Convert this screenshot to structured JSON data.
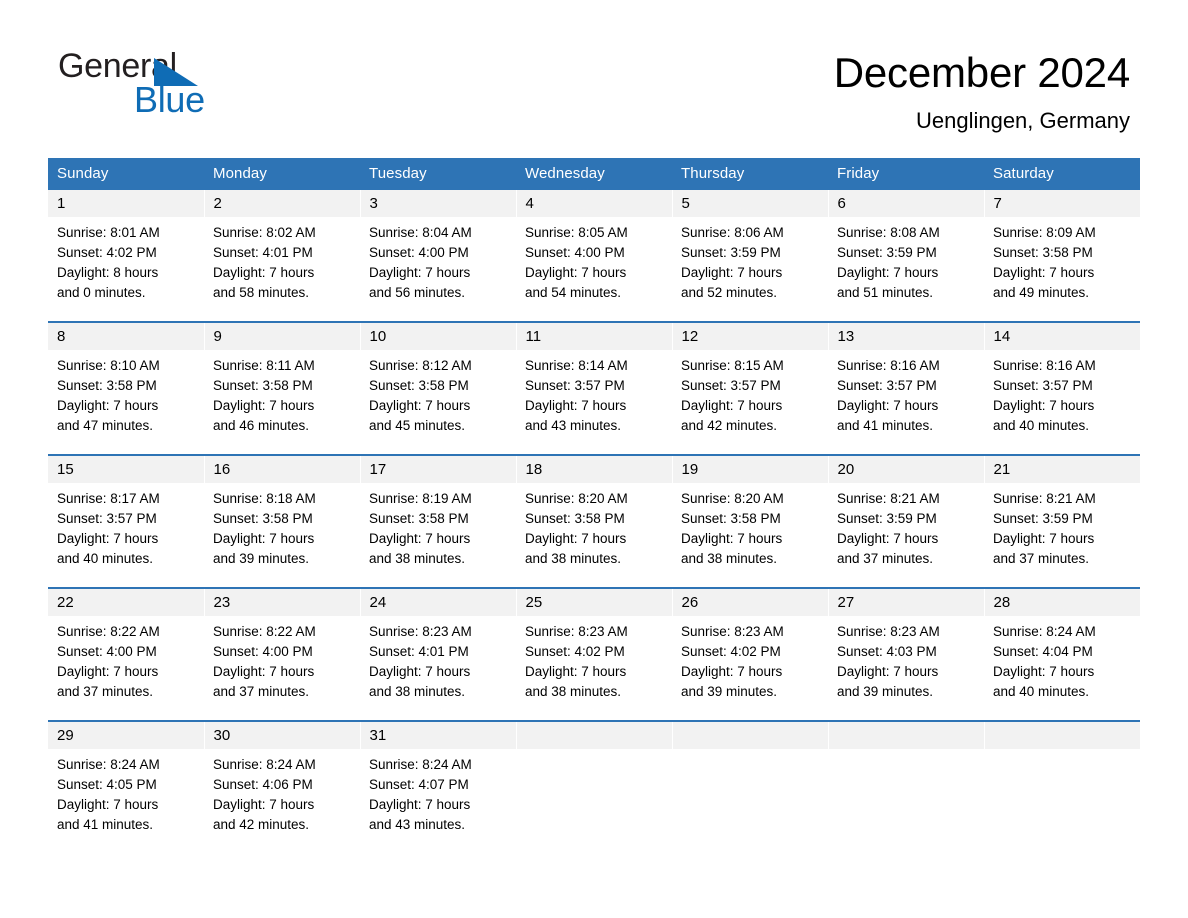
{
  "brand": {
    "name_part1": "General",
    "name_part2": "Blue",
    "triangle_color": "#0f6cb5"
  },
  "header": {
    "title": "December 2024",
    "location": "Uenglingen, Germany"
  },
  "theme": {
    "header_blue": "#2e74b5",
    "daynum_background": "#f2f2f2",
    "page_background": "#ffffff",
    "text_color": "#000000"
  },
  "calendar": {
    "weekday_headers": [
      "Sunday",
      "Monday",
      "Tuesday",
      "Wednesday",
      "Thursday",
      "Friday",
      "Saturday"
    ],
    "weeks": [
      {
        "days": [
          {
            "num": "1",
            "sunrise": "Sunrise: 8:01 AM",
            "sunset": "Sunset: 4:02 PM",
            "daylight_1": "Daylight: 8 hours",
            "daylight_2": "and 0 minutes."
          },
          {
            "num": "2",
            "sunrise": "Sunrise: 8:02 AM",
            "sunset": "Sunset: 4:01 PM",
            "daylight_1": "Daylight: 7 hours",
            "daylight_2": "and 58 minutes."
          },
          {
            "num": "3",
            "sunrise": "Sunrise: 8:04 AM",
            "sunset": "Sunset: 4:00 PM",
            "daylight_1": "Daylight: 7 hours",
            "daylight_2": "and 56 minutes."
          },
          {
            "num": "4",
            "sunrise": "Sunrise: 8:05 AM",
            "sunset": "Sunset: 4:00 PM",
            "daylight_1": "Daylight: 7 hours",
            "daylight_2": "and 54 minutes."
          },
          {
            "num": "5",
            "sunrise": "Sunrise: 8:06 AM",
            "sunset": "Sunset: 3:59 PM",
            "daylight_1": "Daylight: 7 hours",
            "daylight_2": "and 52 minutes."
          },
          {
            "num": "6",
            "sunrise": "Sunrise: 8:08 AM",
            "sunset": "Sunset: 3:59 PM",
            "daylight_1": "Daylight: 7 hours",
            "daylight_2": "and 51 minutes."
          },
          {
            "num": "7",
            "sunrise": "Sunrise: 8:09 AM",
            "sunset": "Sunset: 3:58 PM",
            "daylight_1": "Daylight: 7 hours",
            "daylight_2": "and 49 minutes."
          }
        ]
      },
      {
        "days": [
          {
            "num": "8",
            "sunrise": "Sunrise: 8:10 AM",
            "sunset": "Sunset: 3:58 PM",
            "daylight_1": "Daylight: 7 hours",
            "daylight_2": "and 47 minutes."
          },
          {
            "num": "9",
            "sunrise": "Sunrise: 8:11 AM",
            "sunset": "Sunset: 3:58 PM",
            "daylight_1": "Daylight: 7 hours",
            "daylight_2": "and 46 minutes."
          },
          {
            "num": "10",
            "sunrise": "Sunrise: 8:12 AM",
            "sunset": "Sunset: 3:58 PM",
            "daylight_1": "Daylight: 7 hours",
            "daylight_2": "and 45 minutes."
          },
          {
            "num": "11",
            "sunrise": "Sunrise: 8:14 AM",
            "sunset": "Sunset: 3:57 PM",
            "daylight_1": "Daylight: 7 hours",
            "daylight_2": "and 43 minutes."
          },
          {
            "num": "12",
            "sunrise": "Sunrise: 8:15 AM",
            "sunset": "Sunset: 3:57 PM",
            "daylight_1": "Daylight: 7 hours",
            "daylight_2": "and 42 minutes."
          },
          {
            "num": "13",
            "sunrise": "Sunrise: 8:16 AM",
            "sunset": "Sunset: 3:57 PM",
            "daylight_1": "Daylight: 7 hours",
            "daylight_2": "and 41 minutes."
          },
          {
            "num": "14",
            "sunrise": "Sunrise: 8:16 AM",
            "sunset": "Sunset: 3:57 PM",
            "daylight_1": "Daylight: 7 hours",
            "daylight_2": "and 40 minutes."
          }
        ]
      },
      {
        "days": [
          {
            "num": "15",
            "sunrise": "Sunrise: 8:17 AM",
            "sunset": "Sunset: 3:57 PM",
            "daylight_1": "Daylight: 7 hours",
            "daylight_2": "and 40 minutes."
          },
          {
            "num": "16",
            "sunrise": "Sunrise: 8:18 AM",
            "sunset": "Sunset: 3:58 PM",
            "daylight_1": "Daylight: 7 hours",
            "daylight_2": "and 39 minutes."
          },
          {
            "num": "17",
            "sunrise": "Sunrise: 8:19 AM",
            "sunset": "Sunset: 3:58 PM",
            "daylight_1": "Daylight: 7 hours",
            "daylight_2": "and 38 minutes."
          },
          {
            "num": "18",
            "sunrise": "Sunrise: 8:20 AM",
            "sunset": "Sunset: 3:58 PM",
            "daylight_1": "Daylight: 7 hours",
            "daylight_2": "and 38 minutes."
          },
          {
            "num": "19",
            "sunrise": "Sunrise: 8:20 AM",
            "sunset": "Sunset: 3:58 PM",
            "daylight_1": "Daylight: 7 hours",
            "daylight_2": "and 38 minutes."
          },
          {
            "num": "20",
            "sunrise": "Sunrise: 8:21 AM",
            "sunset": "Sunset: 3:59 PM",
            "daylight_1": "Daylight: 7 hours",
            "daylight_2": "and 37 minutes."
          },
          {
            "num": "21",
            "sunrise": "Sunrise: 8:21 AM",
            "sunset": "Sunset: 3:59 PM",
            "daylight_1": "Daylight: 7 hours",
            "daylight_2": "and 37 minutes."
          }
        ]
      },
      {
        "days": [
          {
            "num": "22",
            "sunrise": "Sunrise: 8:22 AM",
            "sunset": "Sunset: 4:00 PM",
            "daylight_1": "Daylight: 7 hours",
            "daylight_2": "and 37 minutes."
          },
          {
            "num": "23",
            "sunrise": "Sunrise: 8:22 AM",
            "sunset": "Sunset: 4:00 PM",
            "daylight_1": "Daylight: 7 hours",
            "daylight_2": "and 37 minutes."
          },
          {
            "num": "24",
            "sunrise": "Sunrise: 8:23 AM",
            "sunset": "Sunset: 4:01 PM",
            "daylight_1": "Daylight: 7 hours",
            "daylight_2": "and 38 minutes."
          },
          {
            "num": "25",
            "sunrise": "Sunrise: 8:23 AM",
            "sunset": "Sunset: 4:02 PM",
            "daylight_1": "Daylight: 7 hours",
            "daylight_2": "and 38 minutes."
          },
          {
            "num": "26",
            "sunrise": "Sunrise: 8:23 AM",
            "sunset": "Sunset: 4:02 PM",
            "daylight_1": "Daylight: 7 hours",
            "daylight_2": "and 39 minutes."
          },
          {
            "num": "27",
            "sunrise": "Sunrise: 8:23 AM",
            "sunset": "Sunset: 4:03 PM",
            "daylight_1": "Daylight: 7 hours",
            "daylight_2": "and 39 minutes."
          },
          {
            "num": "28",
            "sunrise": "Sunrise: 8:24 AM",
            "sunset": "Sunset: 4:04 PM",
            "daylight_1": "Daylight: 7 hours",
            "daylight_2": "and 40 minutes."
          }
        ]
      },
      {
        "days": [
          {
            "num": "29",
            "sunrise": "Sunrise: 8:24 AM",
            "sunset": "Sunset: 4:05 PM",
            "daylight_1": "Daylight: 7 hours",
            "daylight_2": "and 41 minutes."
          },
          {
            "num": "30",
            "sunrise": "Sunrise: 8:24 AM",
            "sunset": "Sunset: 4:06 PM",
            "daylight_1": "Daylight: 7 hours",
            "daylight_2": "and 42 minutes."
          },
          {
            "num": "31",
            "sunrise": "Sunrise: 8:24 AM",
            "sunset": "Sunset: 4:07 PM",
            "daylight_1": "Daylight: 7 hours",
            "daylight_2": "and 43 minutes."
          },
          {
            "num": "",
            "sunrise": "",
            "sunset": "",
            "daylight_1": "",
            "daylight_2": ""
          },
          {
            "num": "",
            "sunrise": "",
            "sunset": "",
            "daylight_1": "",
            "daylight_2": ""
          },
          {
            "num": "",
            "sunrise": "",
            "sunset": "",
            "daylight_1": "",
            "daylight_2": ""
          },
          {
            "num": "",
            "sunrise": "",
            "sunset": "",
            "daylight_1": "",
            "daylight_2": ""
          }
        ]
      }
    ]
  }
}
